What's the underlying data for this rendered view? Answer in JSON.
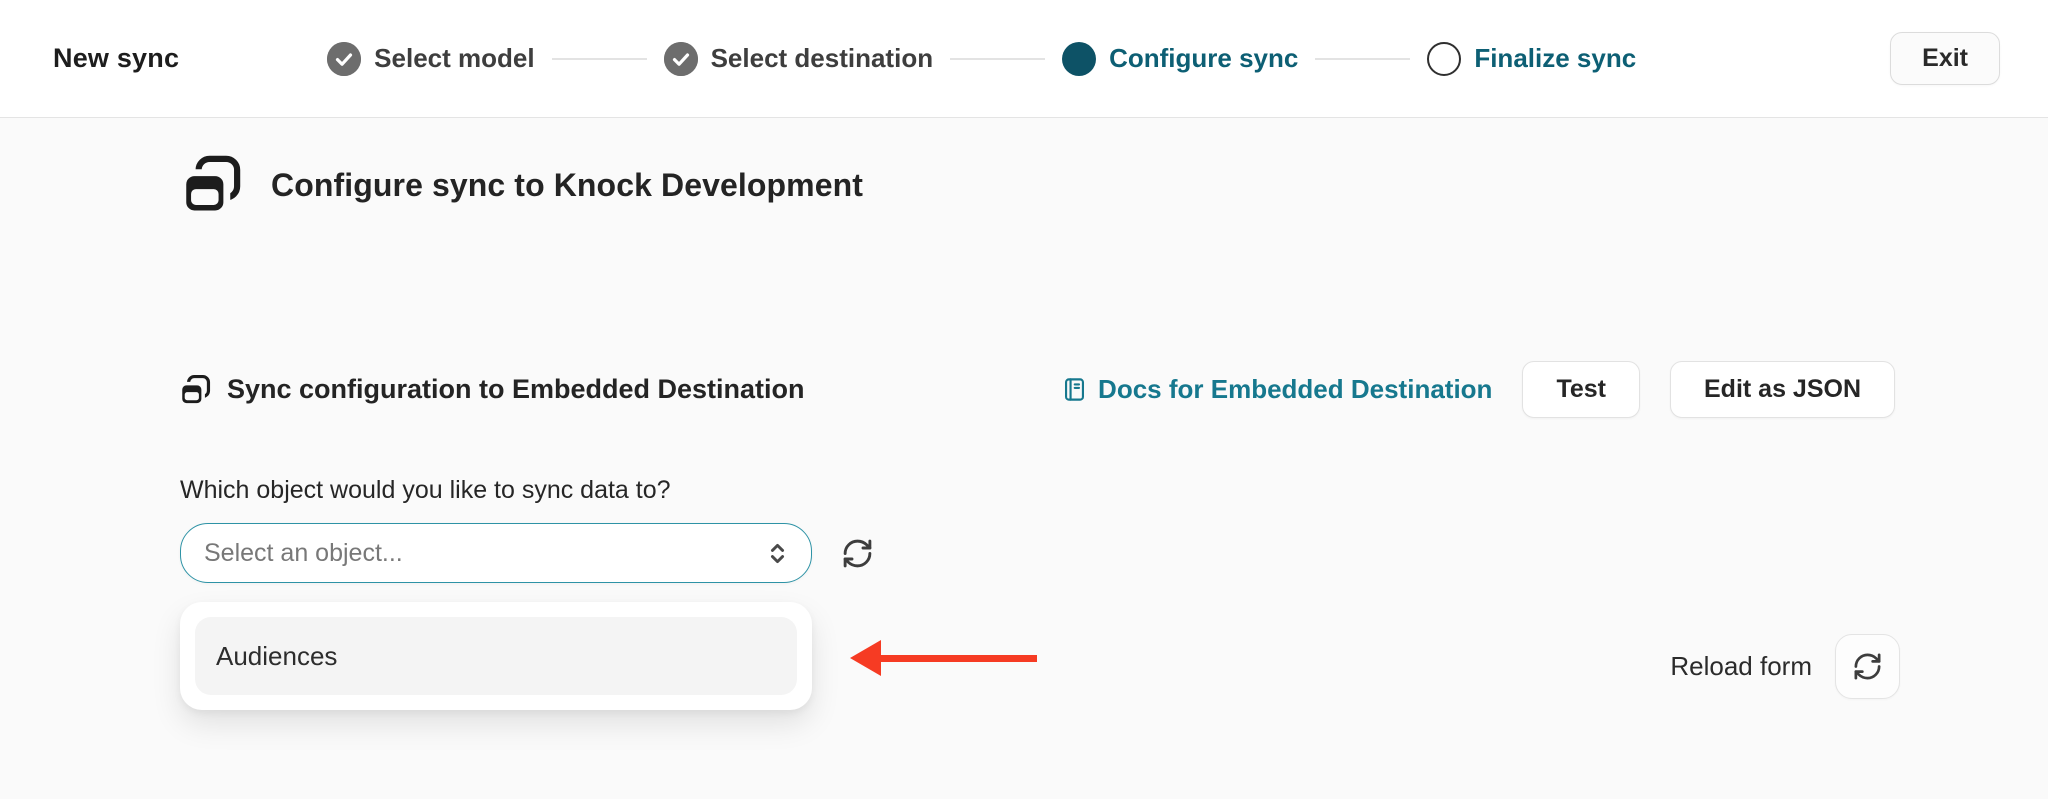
{
  "colors": {
    "accent_teal": "#0d5f74",
    "link_teal": "#16788e",
    "arrow_red": "#f63b23",
    "step_done_gray": "#6d6d6d",
    "surface": "#fafafa"
  },
  "header": {
    "title": "New sync",
    "steps": [
      {
        "label": "Select model",
        "state": "done"
      },
      {
        "label": "Select destination",
        "state": "done"
      },
      {
        "label": "Configure sync",
        "state": "active"
      },
      {
        "label": "Finalize sync",
        "state": "upcoming"
      }
    ],
    "exit_label": "Exit"
  },
  "main": {
    "page_heading": "Configure sync to Knock Development",
    "section": {
      "heading": "Sync configuration to Embedded Destination",
      "docs_link_label": "Docs for Embedded Destination",
      "test_button_label": "Test",
      "edit_json_button_label": "Edit as JSON"
    },
    "form": {
      "object_question": "Which object would you like to sync data to?",
      "select_placeholder": "Select an object...",
      "dropdown_options": [
        "Audiences"
      ]
    },
    "reload_form_label": "Reload form"
  },
  "icons": {
    "window_stack": "window-stack-icon",
    "check_circle": "check-circle-icon",
    "book": "book-icon",
    "chevron_up_down": "chevron-up-down-icon",
    "refresh": "refresh-icon",
    "arrow_annotation": "red-left-arrow"
  }
}
